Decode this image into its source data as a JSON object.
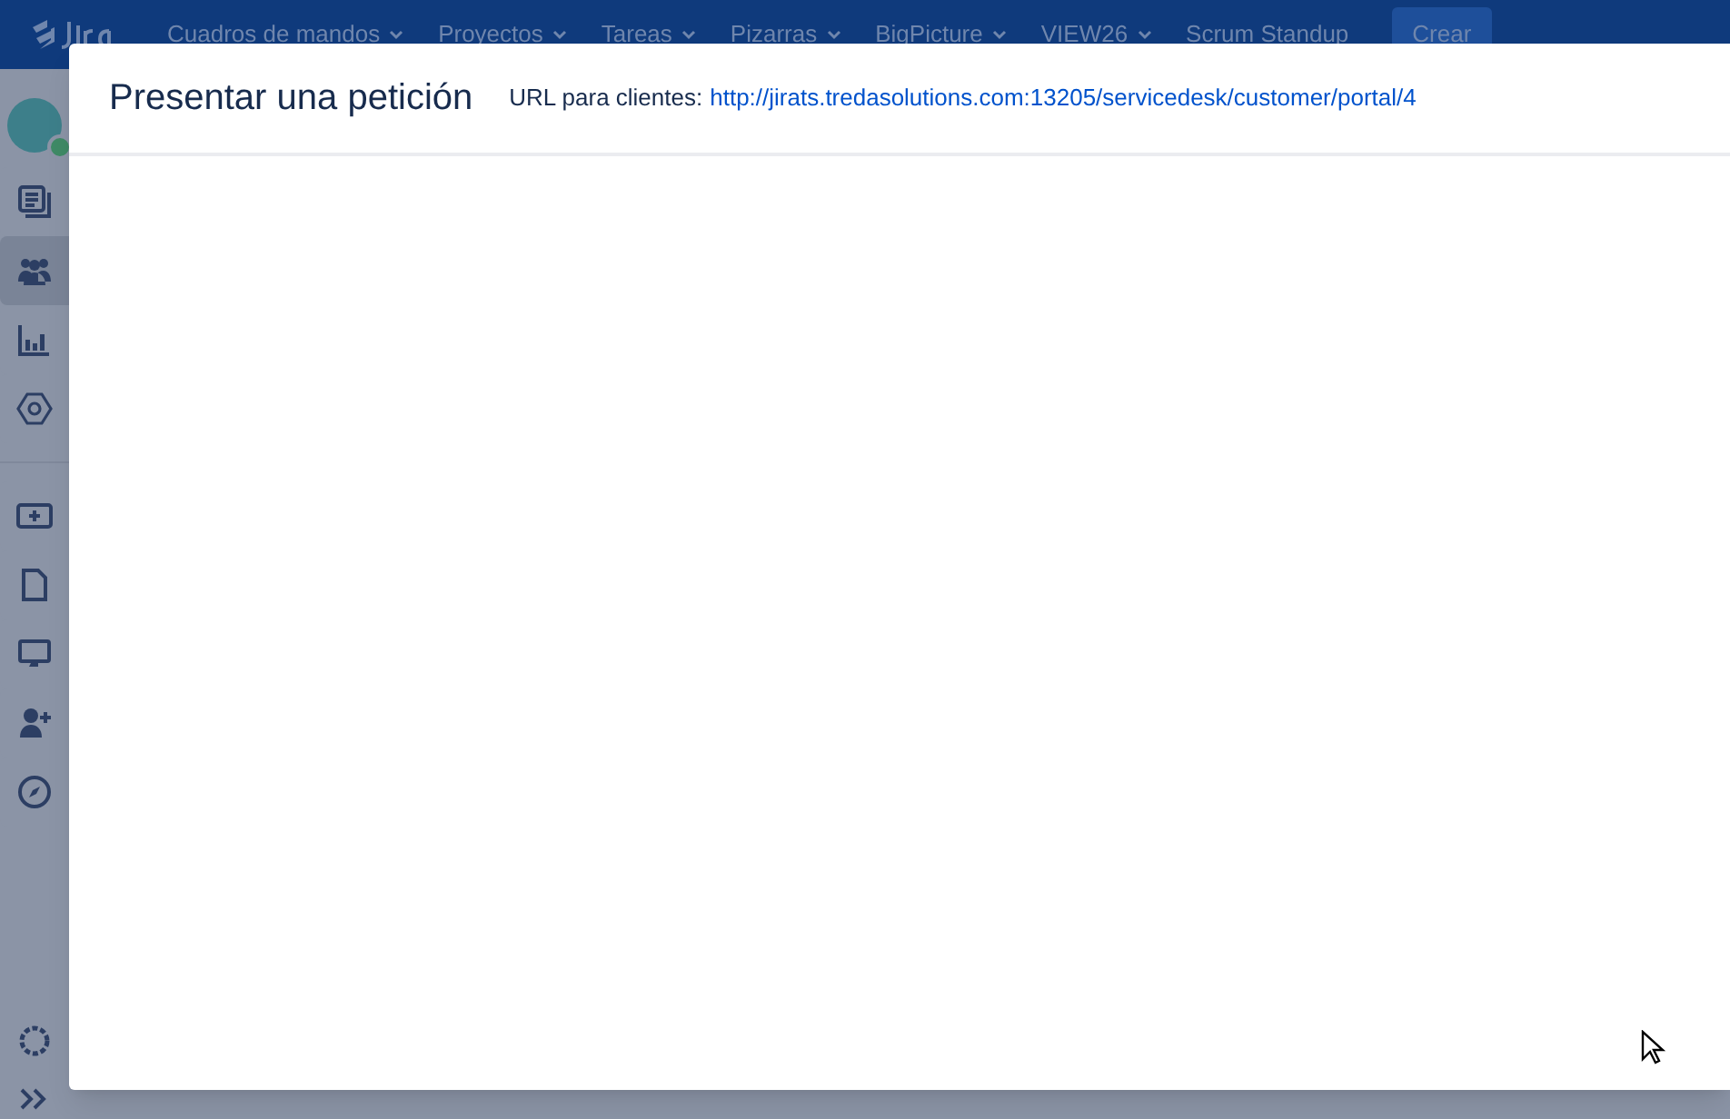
{
  "top_nav": {
    "items": [
      {
        "label": "Cuadros de mandos",
        "kind": "menu"
      },
      {
        "label": "Proyectos",
        "kind": "menu"
      },
      {
        "label": "Tareas",
        "kind": "menu"
      },
      {
        "label": "Pizarras",
        "kind": "menu"
      },
      {
        "label": "BigPicture",
        "kind": "menu"
      },
      {
        "label": "VIEW26",
        "kind": "menu"
      },
      {
        "label": "Scrum Standup",
        "kind": "link"
      }
    ],
    "create_button": "Crear"
  },
  "sidebar": {
    "items": [
      {
        "selected": false
      },
      {
        "selected": true
      },
      {
        "selected": false
      },
      {
        "selected": false
      },
      {
        "selected": false
      },
      {
        "selected": false
      },
      {
        "selected": false
      },
      {
        "selected": false
      },
      {
        "selected": false
      }
    ]
  },
  "dialog": {
    "title": "Presentar una petición",
    "url_label": "URL para clientes:",
    "url": "http://jirats.tredasolutions.com:13205/servicedesk/customer/portal/4"
  }
}
